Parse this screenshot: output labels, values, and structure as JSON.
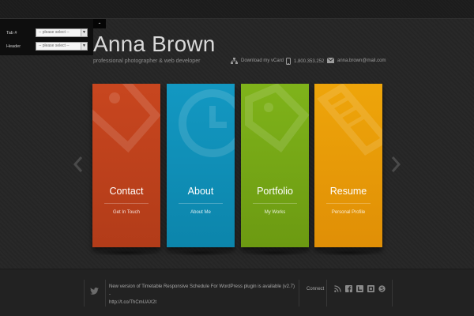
{
  "panel": {
    "toggle": "-",
    "rows": [
      {
        "label": "Tab #",
        "value": "-- please select --"
      },
      {
        "label": "Header",
        "value": "-- please select --"
      }
    ]
  },
  "header": {
    "name": "Anna Brown",
    "tagline": "professional photographer & web developer",
    "vcard": "Download my vCard",
    "phone": "1.800.353.252",
    "email": "anna.brown@mail.com"
  },
  "cards": [
    {
      "title": "Contact",
      "sub": "Get In Touch",
      "color": "#c8461f",
      "color2": "#b23c19",
      "icon": "tag-icon"
    },
    {
      "title": "About",
      "sub": "About Me",
      "color": "#1398c2",
      "color2": "#0c85ab",
      "icon": "clock-icon"
    },
    {
      "title": "Portfolio",
      "sub": "My Works",
      "color": "#7fb31a",
      "color2": "#6c9a12",
      "icon": "tag-icon"
    },
    {
      "title": "Resume",
      "sub": "Personal Profile",
      "color": "#eea50a",
      "color2": "#e08f06",
      "icon": "pencil-icon"
    }
  ],
  "footer": {
    "tweet_text": "New version of Timetable Responsive Schedule For WordPress plugin is available (v2.7) -",
    "tweet_link": "http://t.co/ThCmUAX2t",
    "connect": "Connect",
    "social": [
      "rss-icon",
      "facebook-icon",
      "twitter-icon",
      "linkedin-icon",
      "skype-icon"
    ]
  }
}
